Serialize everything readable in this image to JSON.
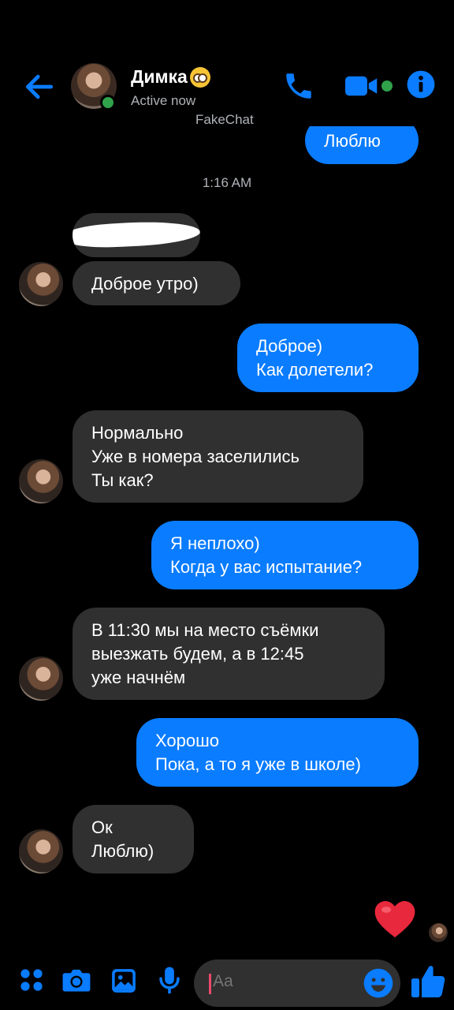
{
  "header": {
    "contact_name": "Димка",
    "status": "Active now",
    "app_label": "FakeChat"
  },
  "timestamp": "1:16 AM",
  "messages": [
    {
      "side": "out",
      "text": "Люблю"
    },
    {
      "side": "in",
      "text": "Доброе утро)"
    },
    {
      "side": "out",
      "text": "Доброе)\nКак долетели?"
    },
    {
      "side": "in",
      "text": "Нормально\nУже в номера заселились\nТы как?"
    },
    {
      "side": "out",
      "text": "Я неплохо)\nКогда у вас испытание?"
    },
    {
      "side": "in",
      "text": "В 11:30 мы на место съёмки\nвыезжать будем, а в 12:45\nуже начнём"
    },
    {
      "side": "out",
      "text": "Хорошо\nПока, а то я уже в школе)"
    },
    {
      "side": "in",
      "text": "Ок\nЛюблю)"
    }
  ],
  "composer": {
    "placeholder": "Aa"
  },
  "colors": {
    "accent": "#0a7cff",
    "incoming_bubble": "#303030",
    "background": "#000000",
    "online": "#31a24c",
    "heart": "#e8283c"
  },
  "icons": [
    "back-arrow-icon",
    "phone-icon",
    "video-camera-icon",
    "info-icon",
    "apps-grid-icon",
    "camera-icon",
    "gallery-icon",
    "microphone-icon",
    "emoji-icon",
    "thumbs-up-icon",
    "heart-icon"
  ]
}
